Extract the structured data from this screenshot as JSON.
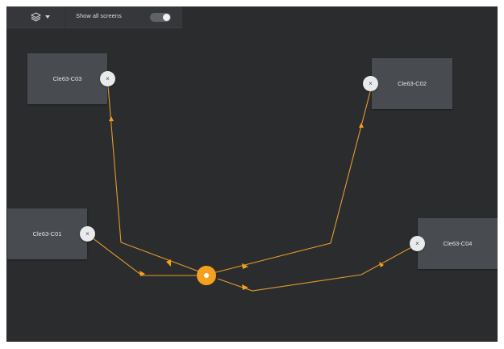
{
  "toolbar": {
    "layers_icon": "layers-icon",
    "dropdown_icon": "caret-down-icon",
    "toggle_label": "Show all screens",
    "toggle_on": true
  },
  "screens": [
    {
      "name": "Cle63-C03",
      "remove": "×"
    },
    {
      "name": "Cle63-C02",
      "remove": "×"
    },
    {
      "name": "Cle63-C01",
      "remove": "×"
    },
    {
      "name": "Cle63-C04",
      "remove": "×"
    }
  ],
  "colors": {
    "canvas": "#2b2c2e",
    "screen_box": "#484b4f",
    "link": "#f5a01e",
    "hub": "#f5a01e"
  }
}
